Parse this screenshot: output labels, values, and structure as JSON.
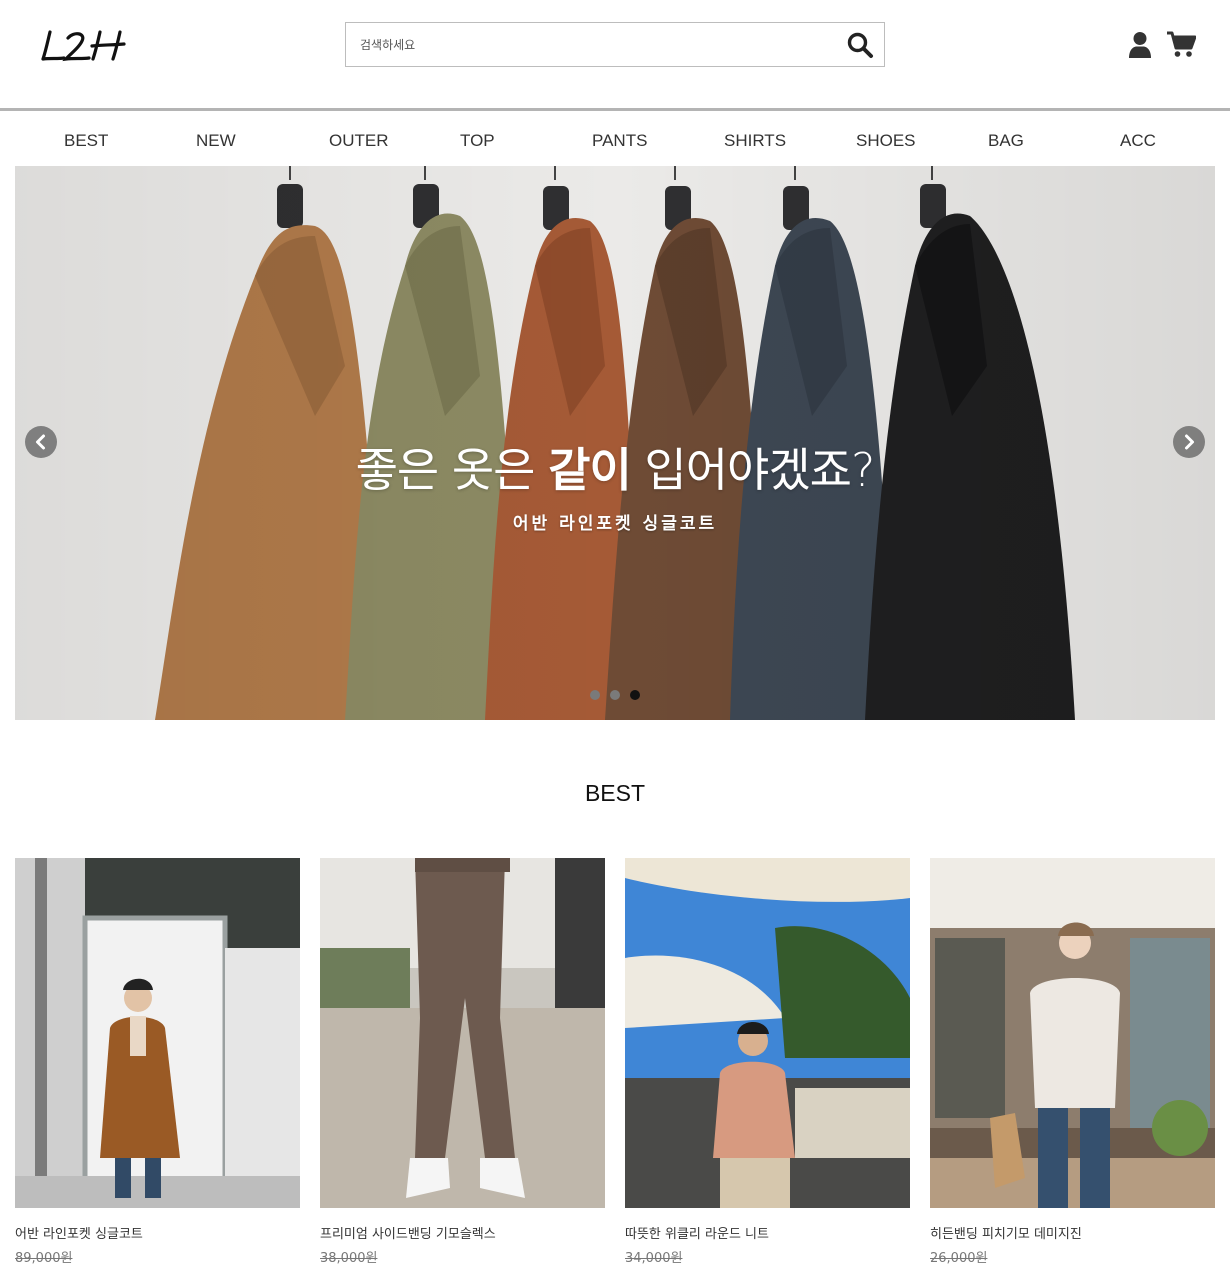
{
  "header": {
    "logo_text": "L2H",
    "search": {
      "placeholder": "검색하세요",
      "value": ""
    },
    "icons": [
      "search-icon",
      "user-icon",
      "cart-icon"
    ]
  },
  "nav": {
    "items": [
      {
        "label": "BEST"
      },
      {
        "label": "NEW"
      },
      {
        "label": "OUTER"
      },
      {
        "label": "TOP"
      },
      {
        "label": "PANTS"
      },
      {
        "label": "SHIRTS"
      },
      {
        "label": "SHOES"
      },
      {
        "label": "BAG"
      },
      {
        "label": "ACC"
      }
    ]
  },
  "banner": {
    "headline_pre": "좋은 옷은 ",
    "headline_bold": "같이",
    "headline_post": " 입어야겠죠?",
    "subtitle": "어반 라인포켓 싱글코트",
    "slide_count": 3,
    "active_slide": 3
  },
  "best": {
    "title": "BEST",
    "products": [
      {
        "name": "어반 라인포켓 싱글코트",
        "price": "89,000원"
      },
      {
        "name": "프리미엄 사이드밴딩 기모슬렉스",
        "price": "38,000원"
      },
      {
        "name": "따뜻한 위클리 라운드 니트",
        "price": "34,000원"
      },
      {
        "name": "히든밴딩 피치기모 데미지진",
        "price": "26,000원"
      }
    ]
  },
  "colors": {
    "text": "#333333",
    "divider": "#b4b4b4",
    "banner_bg": "#ebeae8",
    "coats": [
      "#b07a4a",
      "#8c8a63",
      "#a55a36",
      "#6e4b35",
      "#3d4753",
      "#1f1f20"
    ]
  }
}
